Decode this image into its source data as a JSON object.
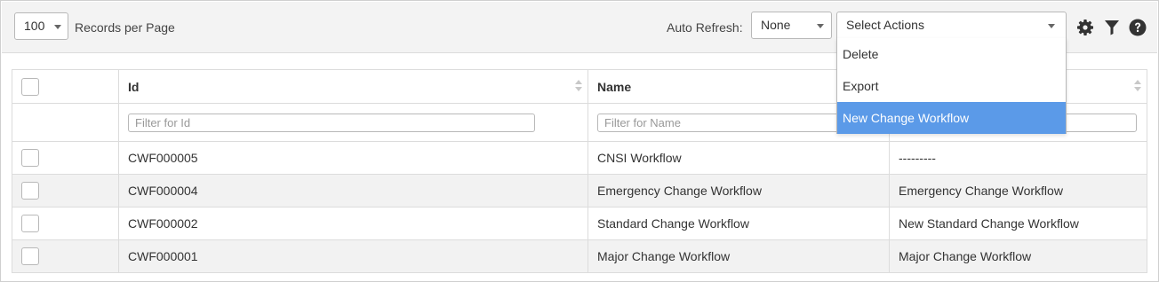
{
  "toolbar": {
    "page_size_value": "100",
    "page_size_label": "Records per Page",
    "auto_refresh_label": "Auto Refresh:",
    "auto_refresh_value": "None",
    "actions_value": "Select Actions",
    "actions_menu": [
      "Delete",
      "Export",
      "New Change Workflow"
    ],
    "icons": [
      "gear-icon",
      "filter-icon",
      "help-icon"
    ]
  },
  "table": {
    "columns": [
      "Id",
      "Name"
    ],
    "filters": {
      "id_placeholder": "Filter for Id",
      "name_placeholder": "Filter for Name"
    },
    "rows": [
      {
        "id": "CWF000005",
        "name": "CNSI Workflow",
        "description": "---------"
      },
      {
        "id": "CWF000004",
        "name": "Emergency Change Workflow",
        "description": "Emergency Change Workflow"
      },
      {
        "id": "CWF000002",
        "name": "Standard Change Workflow",
        "description": "New Standard Change Workflow"
      },
      {
        "id": "CWF000001",
        "name": "Major Change Workflow",
        "description": "Major Change Workflow"
      }
    ]
  },
  "colors": {
    "menu_highlight": "#5b9ae8",
    "toolbar_bg": "#f3f3f3",
    "alt_row_bg": "#f2f2f2"
  }
}
